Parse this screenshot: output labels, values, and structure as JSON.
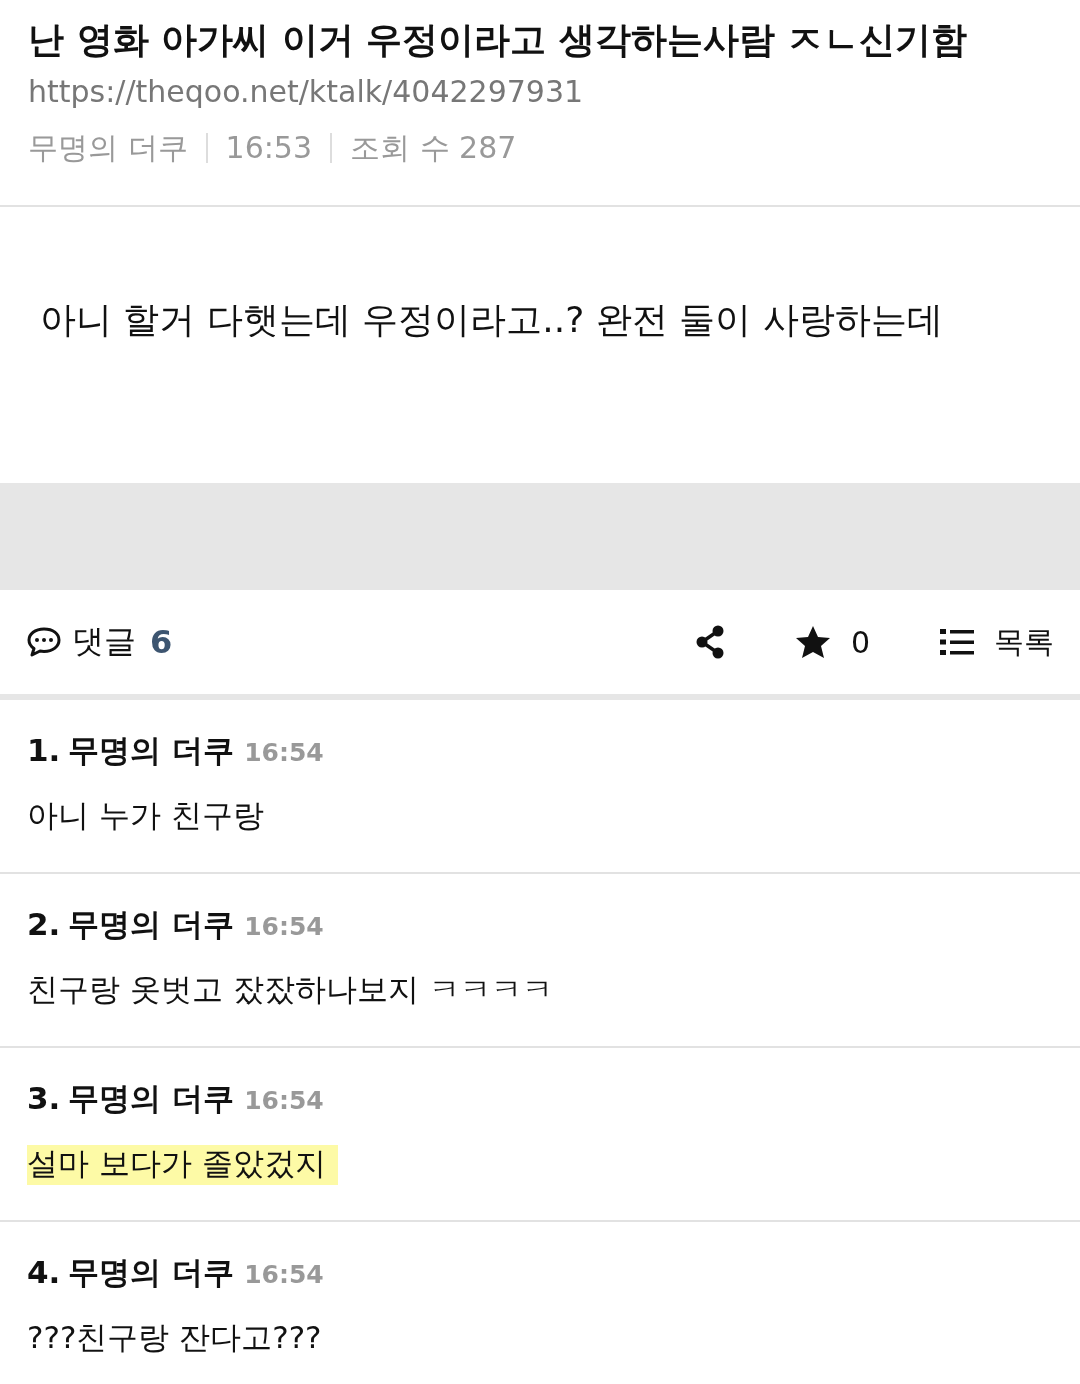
{
  "post": {
    "title": "난 영화 아가씨 이거 우정이라고 생각하는사람 ㅈㄴ신기함",
    "url": "https://theqoo.net/ktalk/4042297931",
    "author": "무명의 더쿠",
    "time": "16:53",
    "views": "조회 수 287",
    "body": "아니 할거 다햇는데 우정이라고..? 완전 둘이 사랑하는데"
  },
  "toolbar": {
    "comments_label": "댓글",
    "comments_count": "6",
    "stars": "0",
    "list_label": "목록"
  },
  "comments": [
    {
      "number": "1.",
      "author": "무명의 더쿠",
      "time": "16:54",
      "text": "아니 누가 친구랑",
      "highlighted": false
    },
    {
      "number": "2.",
      "author": "무명의 더쿠",
      "time": "16:54",
      "text": "친구랑 옷벗고 잤잤하나보지 ㅋㅋㅋㅋ",
      "highlighted": false
    },
    {
      "number": "3.",
      "author": "무명의 더쿠",
      "time": "16:54",
      "text": "설마 보다가 졸았겄지",
      "highlighted": true
    },
    {
      "number": "4.",
      "author": "무명의 더쿠",
      "time": "16:54",
      "text": "???친구랑 잔다고???",
      "highlighted": false
    }
  ]
}
